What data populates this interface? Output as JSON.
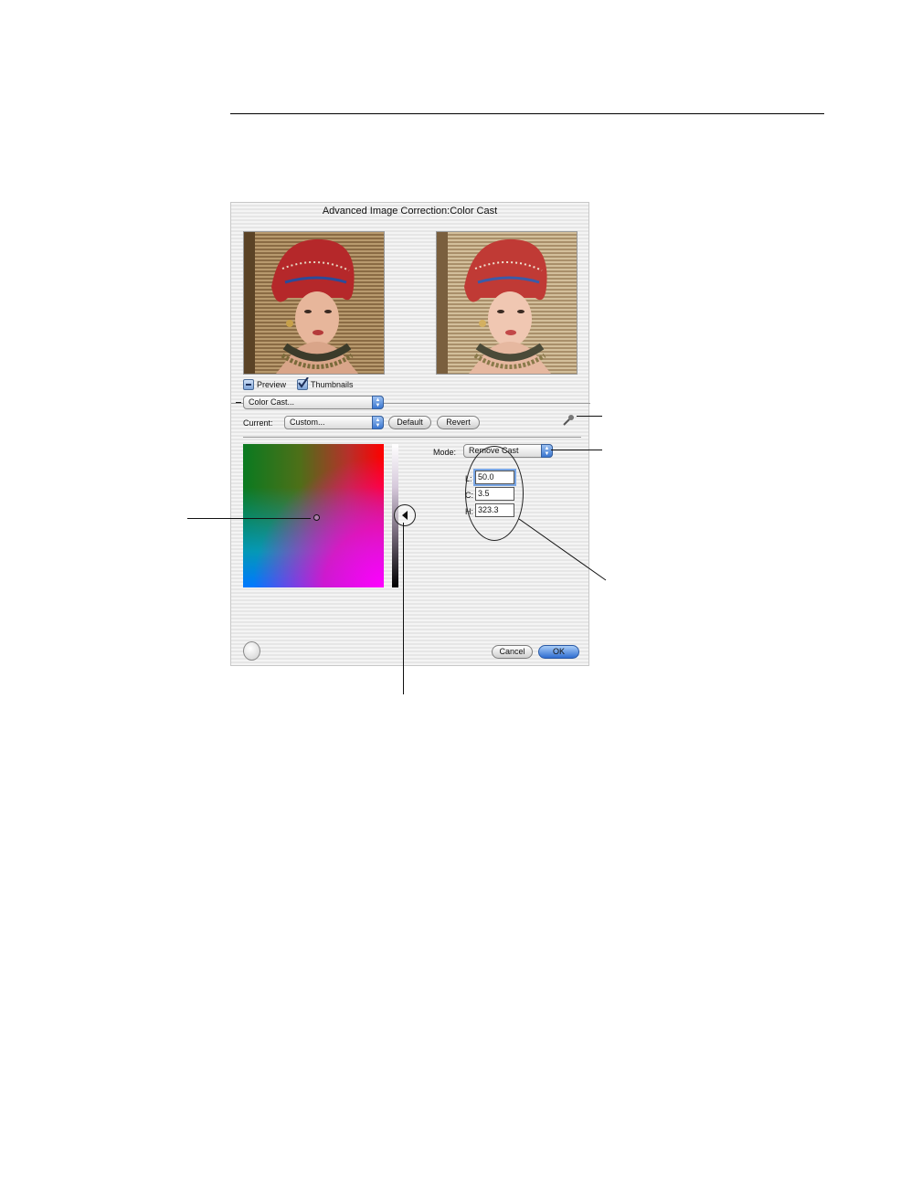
{
  "dialog": {
    "title": "Advanced Image Correction:Color Cast",
    "checkboxes": {
      "preview": "Preview",
      "thumbnails": "Thumbnails"
    },
    "correction_popup": "Color Cast...",
    "current_label": "Current:",
    "current_popup": "Custom...",
    "buttons": {
      "default": "Default",
      "revert": "Revert",
      "cancel": "Cancel",
      "ok": "OK"
    },
    "mode_label": "Mode:",
    "mode_popup": "Remove Cast",
    "fields": {
      "l_label": "L:",
      "l_value": "50.0",
      "c_label": "C:",
      "c_value": "3.5",
      "h_label": "H:",
      "h_value": "323.3"
    }
  },
  "icons": {
    "eyedropper": "eyedropper-icon",
    "slider_pointer": "triangle-left-icon",
    "help": "help-round-icon"
  },
  "colors": {
    "accent_blue": "#3a76cf",
    "dialog_bg": "#ededed"
  }
}
